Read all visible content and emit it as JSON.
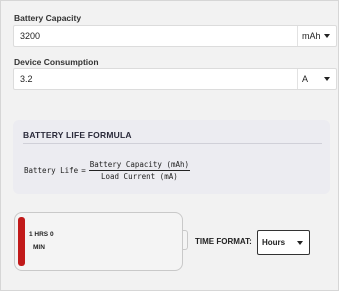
{
  "capacity": {
    "label": "Battery Capacity",
    "value": "3200",
    "unit": "mAh"
  },
  "consumption": {
    "label": "Device Consumption",
    "value": "3.2",
    "unit": "A"
  },
  "formula": {
    "title": "BATTERY LIFE FORMULA",
    "lhs": "Battery Life",
    "eq": "=",
    "numerator": "Battery Capacity (mAh)",
    "denominator": "Load Current (mA)"
  },
  "battery": {
    "line1": "1 HRS 0",
    "line2": "MIN",
    "level_fraction": 0.03,
    "fill_color": "#c11a1a"
  },
  "time_format": {
    "label": "TIME FORMAT:",
    "selected": "Hours"
  },
  "icons": [
    "chevron-down-icon"
  ]
}
